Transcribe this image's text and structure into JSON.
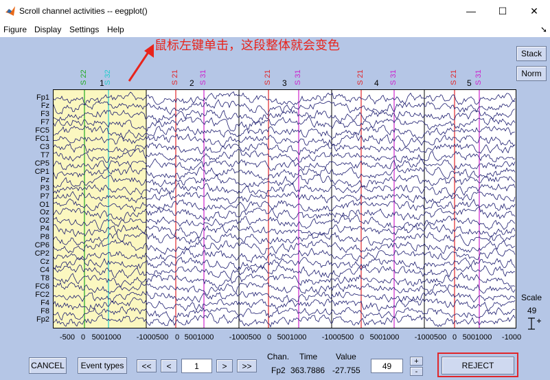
{
  "window": {
    "title": "Scroll channel activities -- eegplot()",
    "minimize": "—",
    "maximize": "☐",
    "close": "✕"
  },
  "menu": {
    "items": [
      "Figure",
      "Display",
      "Settings",
      "Help"
    ],
    "overflow": "➘"
  },
  "annotation": "鼠标左键单击，这段整体就会变色",
  "side_buttons": {
    "stack": "Stack",
    "norm": "Norm"
  },
  "channels": [
    "Fp1",
    "Fz",
    "F3",
    "F7",
    "FC5",
    "FC1",
    "C3",
    "T7",
    "CP5",
    "CP1",
    "Pz",
    "P3",
    "P7",
    "O1",
    "Oz",
    "O2",
    "P4",
    "P8",
    "CP6",
    "CP2",
    "Cz",
    "C4",
    "T8",
    "FC6",
    "FC2",
    "F4",
    "F8",
    "Fp2"
  ],
  "xticks": [
    "-500",
    "0",
    "5001000",
    "-1000500",
    "0",
    "5001000",
    "-1000500",
    "0",
    "5001000",
    "-1000500",
    "0",
    "5001000",
    "-1000500",
    "0",
    "5001000",
    "-1000"
  ],
  "epochs": [
    "1",
    "2",
    "3",
    "4",
    "5"
  ],
  "events": [
    {
      "label": "S 22",
      "color": "#22aa22"
    },
    {
      "label": "S 32",
      "color": "#22cccc"
    },
    {
      "label": "S 21",
      "color": "#e0262a"
    },
    {
      "label": "S 31",
      "color": "#cc22cc"
    },
    {
      "label": "S 21",
      "color": "#e0262a"
    },
    {
      "label": "S 31",
      "color": "#cc22cc"
    },
    {
      "label": "S 21",
      "color": "#e0262a"
    },
    {
      "label": "S 31",
      "color": "#cc22cc"
    },
    {
      "label": "S 21",
      "color": "#e0262a"
    },
    {
      "label": "S 31",
      "color": "#cc22cc"
    }
  ],
  "scale": {
    "label": "Scale",
    "value": "49"
  },
  "controls": {
    "cancel": "CANCEL",
    "event_types": "Event types",
    "first": "<<",
    "prev": "<",
    "page": "1",
    "next": ">",
    "last": ">>",
    "scale_value": "49",
    "plus": "+",
    "minus": "-",
    "reject": "REJECT"
  },
  "readout": {
    "chan_label": "Chan.",
    "time_label": "Time",
    "value_label": "Value",
    "chan": "Fp2",
    "time": "363.7886",
    "value": "-27.755"
  },
  "colors": {
    "trace": "#1a1a6e",
    "highlight": "#fbf7c0",
    "reject_border": "#e0262a"
  }
}
